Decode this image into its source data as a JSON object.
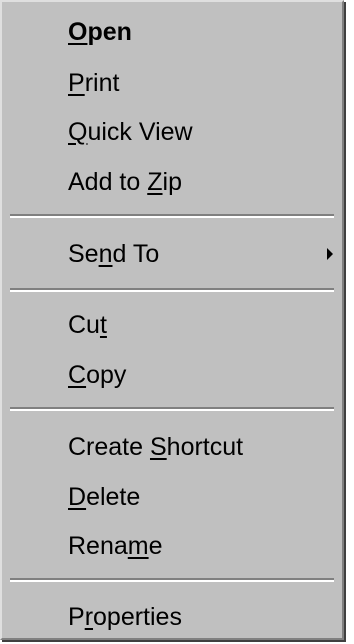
{
  "menu": {
    "items": [
      {
        "key": "open",
        "pre": "",
        "mnemonic": "O",
        "post": "pen",
        "bold": true
      },
      {
        "key": "print",
        "pre": "",
        "mnemonic": "P",
        "post": "rint"
      },
      {
        "key": "quick_view",
        "pre": "",
        "mnemonic": "Q",
        "post": "uick View"
      },
      {
        "key": "add_to_zip",
        "pre": "Add to ",
        "mnemonic": "Z",
        "post": "ip"
      },
      {
        "key": "send_to",
        "pre": "Se",
        "mnemonic": "n",
        "post": "d To",
        "submenu_icon": "submenu-arrow-icon"
      },
      {
        "key": "cut",
        "pre": "Cu",
        "mnemonic": "t",
        "post": ""
      },
      {
        "key": "copy",
        "pre": "",
        "mnemonic": "C",
        "post": "opy"
      },
      {
        "key": "create_shortcut",
        "pre": "Create ",
        "mnemonic": "S",
        "post": "hortcut"
      },
      {
        "key": "delete",
        "pre": "",
        "mnemonic": "D",
        "post": "elete"
      },
      {
        "key": "rename",
        "pre": "Rena",
        "mnemonic": "m",
        "post": "e"
      },
      {
        "key": "properties",
        "pre": "P",
        "mnemonic": "r",
        "post": "operties"
      }
    ]
  },
  "colors": {
    "menu_background": "#c0c0c0",
    "text": "#000000",
    "separator_dark": "#808080",
    "separator_light": "#ffffff"
  }
}
